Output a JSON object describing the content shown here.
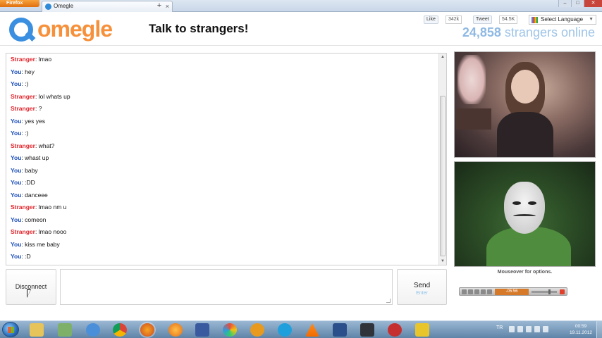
{
  "browser": {
    "app_button": "Firefox",
    "tab_title": "Omegle",
    "tab_close": "×",
    "new_tab": "+"
  },
  "header": {
    "logo_text": "omegle",
    "tagline": "Talk to strangers!",
    "like_label": "Like",
    "like_count": "342k",
    "tweet_label": "Tweet",
    "tweet_count": "54.5K",
    "language_label": "Select Language",
    "online_count": "24,858",
    "online_suffix": " strangers online"
  },
  "chat": {
    "messages": [
      {
        "who": "Stranger",
        "text": "lmao"
      },
      {
        "who": "You",
        "text": "hey"
      },
      {
        "who": "You",
        "text": ":)"
      },
      {
        "who": "Stranger",
        "text": "lol whats up"
      },
      {
        "who": "Stranger",
        "text": "?"
      },
      {
        "who": "You",
        "text": "yes yes"
      },
      {
        "who": "You",
        "text": ":)"
      },
      {
        "who": "Stranger",
        "text": "what?"
      },
      {
        "who": "You",
        "text": "whast up"
      },
      {
        "who": "You",
        "text": "baby"
      },
      {
        "who": "You",
        "text": ":DD"
      },
      {
        "who": "You",
        "text": "danceee"
      },
      {
        "who": "Stranger",
        "text": "lmao nm u"
      },
      {
        "who": "You",
        "text": "comeon"
      },
      {
        "who": "Stranger",
        "text": "lmao nooo"
      },
      {
        "who": "You",
        "text": "kiss me baby"
      },
      {
        "who": "You",
        "text": ":D"
      }
    ]
  },
  "controls": {
    "disconnect_label": "Disconnect",
    "send_label": "Send",
    "send_hint": "Enter"
  },
  "video": {
    "hint": "Mouseover for options.",
    "player_time": "-05:56"
  },
  "taskbar": {
    "language": "TR",
    "time": "00:59",
    "date": "19.11.2012"
  },
  "colors": {
    "stranger": "#e0242b",
    "you": "#1d4fb8",
    "brand_orange": "#f7903a",
    "brand_blue": "#3b8fe0"
  }
}
